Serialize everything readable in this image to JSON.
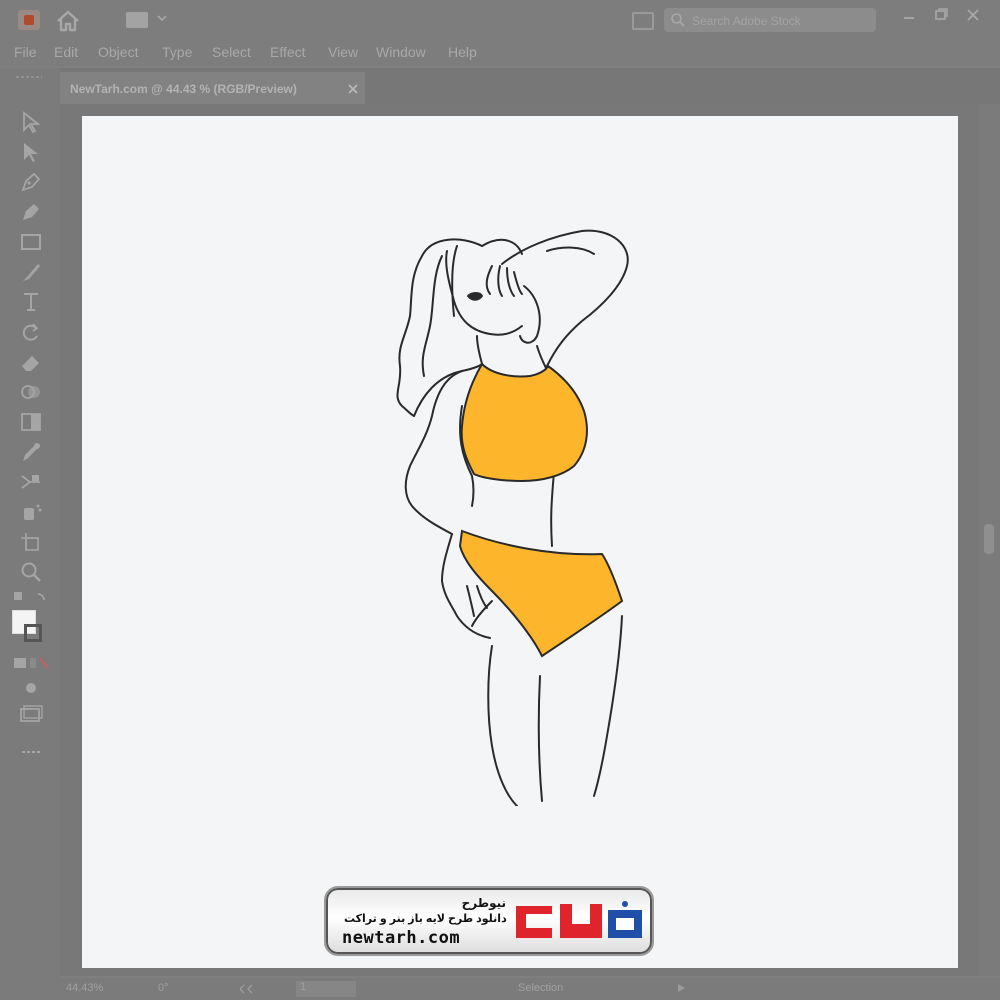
{
  "app": {
    "search_placeholder": "Search Adobe Stock"
  },
  "menu": {
    "items": [
      {
        "label": "File"
      },
      {
        "label": "Edit"
      },
      {
        "label": "Object"
      },
      {
        "label": "Type"
      },
      {
        "label": "Select"
      },
      {
        "label": "Effect"
      },
      {
        "label": "View"
      },
      {
        "label": "Window"
      },
      {
        "label": "Help"
      }
    ]
  },
  "document": {
    "tab_label": "NewTarh.com @ 44.43 % (RGB/Preview)"
  },
  "colors": {
    "bikini_fill": "#FDB52B",
    "outline": "#222222",
    "artboard": "#F4F5F6",
    "logo_red": "#E0242C",
    "logo_blue": "#1F4FA8"
  },
  "watermark": {
    "title": "نیوطرح",
    "subtitle": "دانلود طرح لایه باز بنر و تراکت",
    "url": "newtarh.com"
  },
  "status": {
    "zoom": "44.43%",
    "rotation": "0°",
    "artboard": "1",
    "tool": "Selection"
  }
}
